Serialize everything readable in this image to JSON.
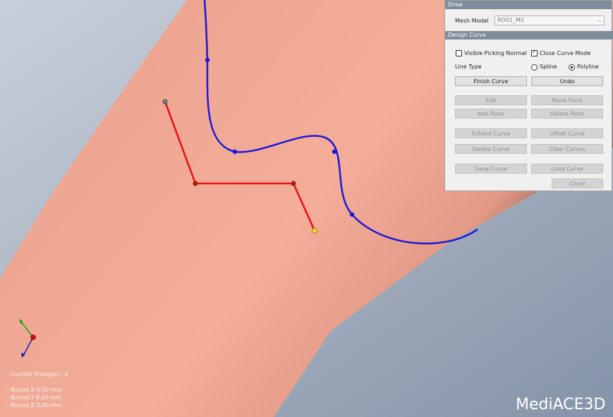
{
  "draw_section": {
    "title": "Draw",
    "mesh_model_label": "Mesh Model",
    "mesh_model_value": "RD01_M0"
  },
  "design_section": {
    "title": "Design Curve",
    "visible_picking_normal_label": "Visible Picking Normal",
    "visible_picking_normal_checked": false,
    "close_curve_mode_label": "Close Curve Mode",
    "close_curve_mode_checked": true,
    "line_type_label": "Line Type",
    "spline_label": "Spline",
    "polyline_label": "Polyline",
    "line_type_selected": "Polyline",
    "buttons": {
      "finish_curve": "Finish Curve",
      "undo": "Undo",
      "edit": "Edit",
      "move_point": "Move Point",
      "add_point": "Add Point",
      "delete_point": "Delete Point",
      "extend_curve": "Extend Curve",
      "offset_curve": "Offset Curve",
      "delete_curve": "Delete Curve",
      "clear_curves": "Clear Curves",
      "save_curve": "Save Curve",
      "load_curve": "Load Curve",
      "close": "Close"
    }
  },
  "stats": {
    "current_triangles": "- Current Triangles : 0",
    "bound_x": "- Bound X   0.00 mm",
    "bound_y": "- Bound Y   0.00 mm",
    "bound_z": "- Bound Z   0.00 mm"
  },
  "logo_text": "MediACE3D",
  "colors": {
    "mesh": "#f0a996",
    "background": "#9aa6b8",
    "blue_curve": "#1c18d8",
    "red_curve": "#ee1111",
    "panel_header": "#7f8c99"
  }
}
